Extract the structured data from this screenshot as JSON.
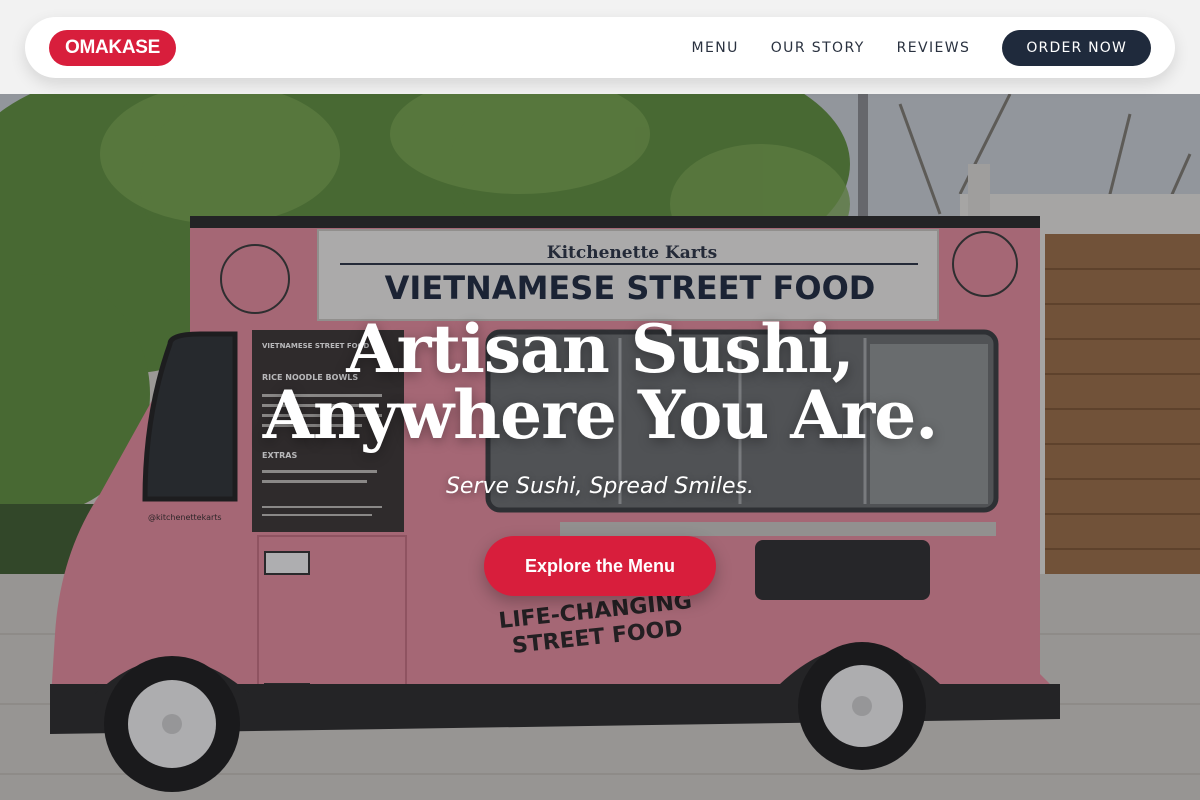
{
  "nav": {
    "logo": "OMAKASE",
    "links": [
      "MENU",
      "OUR STORY",
      "REVIEWS"
    ],
    "cta": "ORDER NOW"
  },
  "hero": {
    "title_line1": "Artisan Sushi,",
    "title_line2": "Anywhere You Are.",
    "subtitle": "Serve Sushi, Spread Smiles.",
    "cta": "Explore the Menu",
    "image": {
      "sign_top": "Kitchenette Karts",
      "sign_main": "VIETNAMESE STREET FOOD",
      "menu_board": [
        "VIETNAMESE STREET FOOD",
        "RICE NOODLE BOWLS",
        "EXTRAS"
      ],
      "handle": "@kitchenettekarts",
      "side_text": [
        "LIFE-CHANGING",
        "STREET FOOD"
      ]
    }
  },
  "colors": {
    "brand_red": "#d81e3c",
    "navy": "#1f2a3c",
    "truck_pink": "#e48c9c"
  }
}
